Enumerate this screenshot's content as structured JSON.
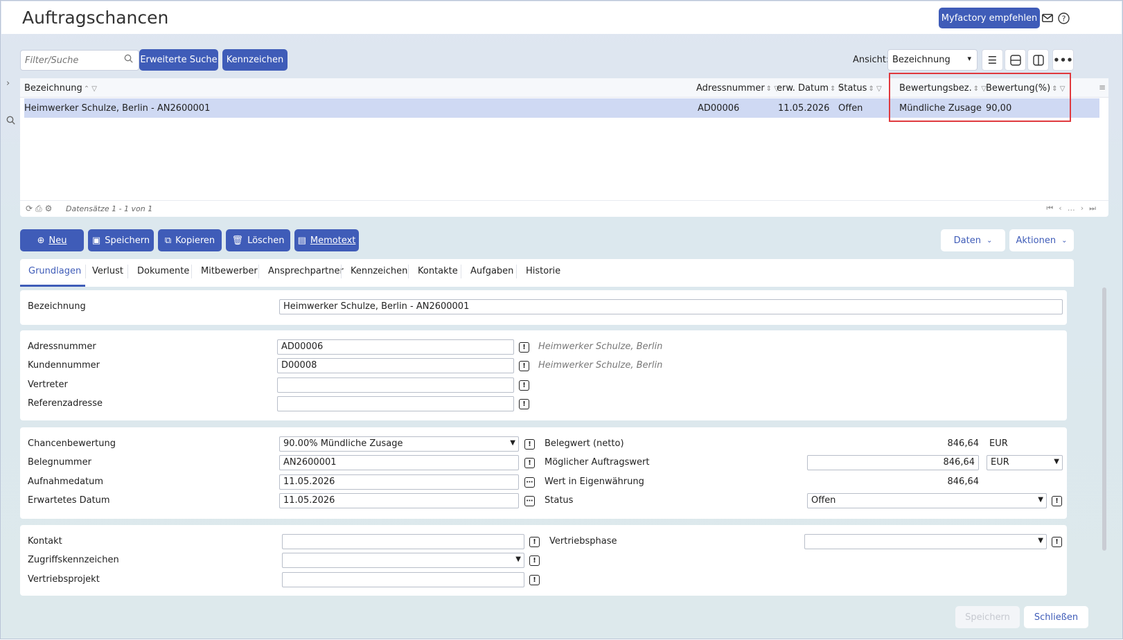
{
  "window": {
    "title": "Auftragschancen"
  },
  "header": {
    "recommend_button": "Myfactory empfehlen",
    "icons": [
      "mail-icon",
      "help-icon"
    ]
  },
  "toolbar": {
    "search_placeholder": "Filter/Suche",
    "advanced_search": "Erweiterte Suche",
    "tags": "Kennzeichen",
    "view_label": "Ansicht:",
    "view_value": "Bezeichnung"
  },
  "grid": {
    "columns": [
      "Bezeichnung",
      "Adressnummer",
      "erw. Datum",
      "Status",
      "Bewertungsbez.",
      "Bewertung(%)"
    ],
    "rows": [
      {
        "bezeichnung": "Heimwerker Schulze, Berlin - AN2600001",
        "adressnummer": "AD00006",
        "datum": "11.05.2026",
        "status": "Offen",
        "bewertungsbez": "Mündliche Zusage",
        "bewertung": "90,00"
      }
    ],
    "footer_text": "Datensätze 1 - 1 von 1"
  },
  "actions": {
    "new": "Neu",
    "save": "Speichern",
    "copy": "Kopieren",
    "delete": "Löschen",
    "memo": "Memotext",
    "data": "Daten",
    "actions": "Aktionen"
  },
  "tabs": [
    "Grundlagen",
    "Verlust",
    "Dokumente",
    "Mitbewerber",
    "Ansprechpartner",
    "Kennzeichen",
    "Kontakte",
    "Aufgaben",
    "Historie"
  ],
  "form": {
    "bezeichnung_label": "Bezeichnung",
    "bezeichnung_value": "Heimwerker Schulze, Berlin - AN2600001",
    "adressnummer_label": "Adressnummer",
    "adressnummer_value": "AD00006",
    "adressnummer_hint": "Heimwerker Schulze, Berlin",
    "kundennummer_label": "Kundennummer",
    "kundennummer_value": "D00008",
    "kundennummer_hint": "Heimwerker Schulze, Berlin",
    "vertreter_label": "Vertreter",
    "referenzadresse_label": "Referenzadresse",
    "chancenbewertung_label": "Chancenbewertung",
    "chancenbewertung_value": "90.00% Mündliche Zusage",
    "belegnummer_label": "Belegnummer",
    "belegnummer_value": "AN2600001",
    "aufnahmedatum_label": "Aufnahmedatum",
    "aufnahmedatum_value": "11.05.2026",
    "erwartetes_datum_label": "Erwartetes Datum",
    "erwartetes_datum_value": "11.05.2026",
    "belegwert_label": "Belegwert (netto)",
    "belegwert_value": "846,64",
    "belegwert_currency": "EUR",
    "moeglicher_label": "Möglicher Auftragswert",
    "moeglicher_value": "846,64",
    "moeglicher_currency": "EUR",
    "eigenwaehrung_label": "Wert in Eigenwährung",
    "eigenwaehrung_value": "846,64",
    "status_label": "Status",
    "status_value": "Offen",
    "kontakt_label": "Kontakt",
    "vertriebsphase_label": "Vertriebsphase",
    "zugriffskennzeichen_label": "Zugriffskennzeichen",
    "vertriebsprojekt_label": "Vertriebsprojekt"
  },
  "bottom": {
    "save": "Speichern",
    "close": "Schließen"
  }
}
